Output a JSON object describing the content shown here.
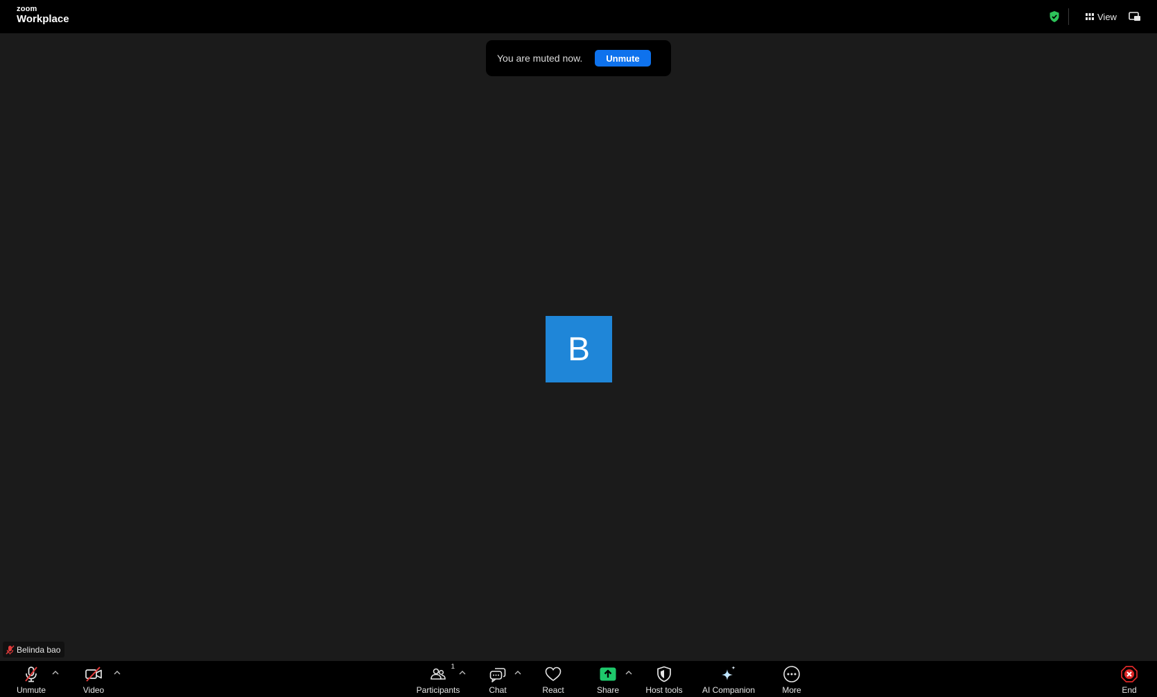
{
  "topbar": {
    "logo_small": "zoom",
    "logo_main": "Workplace",
    "view_label": "View"
  },
  "toast": {
    "message": "You are muted now.",
    "button": "Unmute"
  },
  "avatar": {
    "initial": "B",
    "color": "#1f86d8"
  },
  "nametag": {
    "name": "Belinda bao"
  },
  "toolbar": {
    "unmute": "Unmute",
    "video": "Video",
    "participants": "Participants",
    "participants_count": "1",
    "chat": "Chat",
    "react": "React",
    "share": "Share",
    "host_tools": "Host tools",
    "ai_companion": "AI Companion",
    "more": "More",
    "end": "End"
  },
  "colors": {
    "accent": "#0e72ed",
    "share_green": "#1ec86b",
    "end_red": "#e02828",
    "muted_red": "#e03b3b",
    "secure_green": "#2dc45a"
  },
  "icons": [
    "mic-muted-icon",
    "video-off-icon",
    "participants-icon",
    "chat-icon",
    "heart-icon",
    "share-arrow-icon",
    "shield-icon",
    "sparkle-icon",
    "more-dots-icon",
    "end-x-icon",
    "grid-icon",
    "screen-icon"
  ]
}
